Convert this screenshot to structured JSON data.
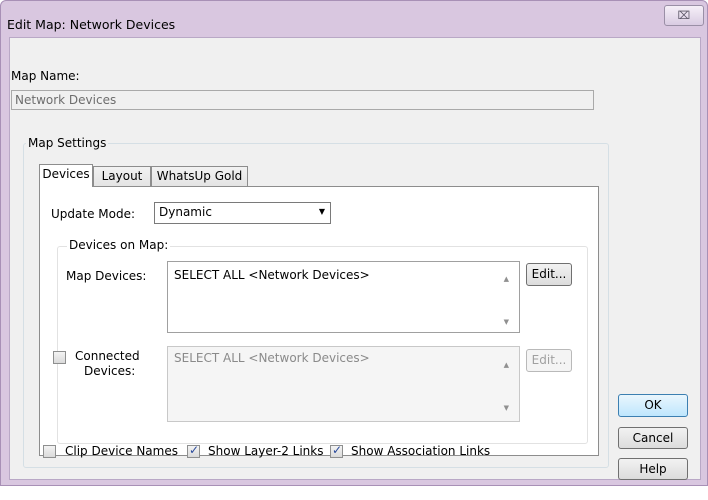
{
  "window": {
    "title": "Edit Map: Network Devices",
    "close_glyph": "⌧"
  },
  "map_name": {
    "label": "Map Name:",
    "value": "Network Devices"
  },
  "map_settings": {
    "title": "Map Settings",
    "tabs": [
      {
        "label": "Devices",
        "active": true
      },
      {
        "label": "Layout",
        "active": false
      },
      {
        "label": "WhatsUp Gold",
        "active": false
      }
    ],
    "update_mode": {
      "label": "Update Mode:",
      "value": "Dynamic"
    },
    "devices_on_map": {
      "title": "Devices on Map:",
      "map_devices": {
        "label": "Map Devices:",
        "value": "SELECT ALL <Network Devices>",
        "edit_label": "Edit..."
      },
      "connected_devices": {
        "label_line1": "Connected",
        "label_line2": "Devices:",
        "checked": false,
        "value": "SELECT ALL <Network Devices>",
        "edit_label": "Edit..."
      }
    },
    "options": {
      "clip_device_names": {
        "label": "Clip Device Names",
        "checked": false
      },
      "show_layer2_links": {
        "label": "Show Layer-2 Links",
        "checked": true
      },
      "show_association_links": {
        "label": "Show Association Links",
        "checked": true
      }
    }
  },
  "buttons": {
    "ok": "OK",
    "cancel": "Cancel",
    "help": "Help"
  }
}
